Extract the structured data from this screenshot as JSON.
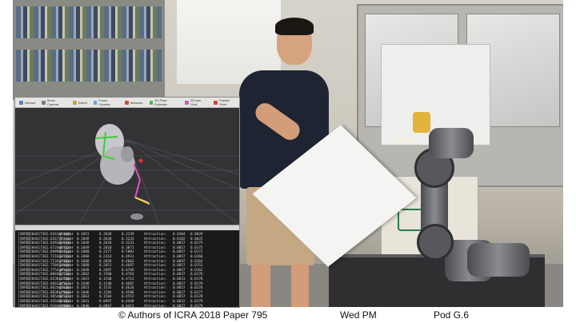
{
  "rviz": {
    "toolbar": [
      {
        "label": "Interact",
        "icon": "interact-icon",
        "color": "#5b7fbf"
      },
      {
        "label": "Move Camera",
        "icon": "move-camera-icon",
        "color": "#7d7d7d"
      },
      {
        "label": "Select",
        "icon": "select-icon",
        "color": "#c9a13a"
      },
      {
        "label": "Focus Camera",
        "icon": "focus-camera-icon",
        "color": "#6aa0d8"
      },
      {
        "label": "Measure",
        "icon": "measure-icon",
        "color": "#d04b3b"
      },
      {
        "label": "2D Pose Estimate",
        "icon": "pose-estimate-icon",
        "color": "#4caf50"
      },
      {
        "label": "2D Nav Goal",
        "icon": "nav-goal-icon",
        "color": "#c65ab8"
      },
      {
        "label": "Publish Point",
        "icon": "publish-point-icon",
        "color": "#d8442f"
      }
    ],
    "status_left": "",
    "status_right": "",
    "log_rows": [
      [
        "[INFO]",
        "[1504417362.616165469]:",
        "gripper",
        "0.1051",
        "0.2628",
        "0.3239",
        "Attraction:",
        "0.0204",
        "0.0029"
      ],
      [
        "[INFO]",
        "[1504417362.626775314]:",
        "gripper",
        "0.1049",
        "0.2628",
        "0.3233",
        "Attraction:",
        "0.0102",
        "0.0025"
      ],
      [
        "[INFO]",
        "[1504417362.646364819]:",
        "gripper",
        "0.1049",
        "0.2628",
        "0.3233",
        "Attraction:",
        "0.0057",
        "0.0175"
      ],
      [
        "[INFO]",
        "[1504417362.672446352]:",
        "gripper",
        "0.1049",
        "0.2610",
        "0.3071",
        "Attraction:",
        "0.0057",
        "0.0175"
      ],
      [
        "[INFO]",
        "[1504417362.698993453]:",
        "gripper",
        "0.1060",
        "0.2377",
        "0.5083",
        "Attraction:",
        "0.0057",
        "0.0172"
      ],
      [
        "[INFO]",
        "[1504417362.721643375]:",
        "gripper",
        "0.1060",
        "0.2314",
        "0.4931",
        "Attraction:",
        "0.0057",
        "0.0166"
      ],
      [
        "[INFO]",
        "[1504417362.723437485]:",
        "gripper",
        "0.1068",
        "0.2058",
        "0.4802",
        "Attraction:",
        "0.0097",
        "0.0164"
      ],
      [
        "[INFO]",
        "[1504417362.758431849]:",
        "gripper",
        "0.1060",
        "0.2051",
        "0.4697",
        "Attraction:",
        "0.0057",
        "0.0153"
      ],
      [
        "[INFO]",
        "[1504417362.775439545]:",
        "gripper",
        "0.1049",
        "0.2097",
        "0.4769",
        "Attraction:",
        "0.0057",
        "0.0162"
      ],
      [
        "[INFO]",
        "[1504417362.804482176]:",
        "gripper",
        "0.1062",
        "0.1560",
        "0.4763",
        "Attraction:",
        "0.0037",
        "0.0176"
      ],
      [
        "[INFO]",
        "[1504417362.823813758]:",
        "gripper",
        "0.1041",
        "0.1540",
        "0.4713",
        "Attraction:",
        "0.0031",
        "0.0178"
      ],
      [
        "[INFO]",
        "[1504417362.846334561]:",
        "gripper",
        "0.1048",
        "0.1540",
        "0.4687",
        "Attraction:",
        "0.0057",
        "0.0178"
      ],
      [
        "[INFO]",
        "[1504417362.862445836]:",
        "gripper",
        "0.1053",
        "0.1535",
        "0.4626",
        "Attraction:",
        "0.0057",
        "0.0176"
      ],
      [
        "[INFO]",
        "[1504417362.883817969]:",
        "gripper",
        "0.1046",
        "0.1504",
        "0.4586",
        "Attraction:",
        "0.0027",
        "0.0177"
      ],
      [
        "[INFO]",
        "[1504417362.905446137]:",
        "gripper",
        "0.1063",
        "0.1504",
        "0.4552",
        "Attraction:",
        "0.0057",
        "0.0178"
      ],
      [
        "[INFO]",
        "[1504417362.926485405]:",
        "gripper",
        "0.1041",
        "0.0997",
        "0.4448",
        "Attraction:",
        "0.0022",
        "0.0179"
      ],
      [
        "[INFO]",
        "[1504417362.934424809]:",
        "gripper",
        "0.1046",
        "0.0967",
        "0.4413",
        "Attraction:",
        "0.0057",
        "0.0179"
      ],
      [
        "[INFO]",
        "[1504417362.956438112]:",
        "gripper",
        "0.1048",
        "0.0033",
        "0.4369",
        "Attraction:",
        "0.0057",
        "0.0179"
      ],
      [
        "[INFO]",
        "[1504417362.968751926]:",
        "gripper",
        "0.1046",
        "0.0033",
        "0.4350",
        "Attraction:",
        "0.0057",
        "0.0180"
      ],
      [
        "[INFO]",
        "[1504417362.985621843]:",
        "gripper",
        "0.1061",
        "0.0033",
        "0.4339",
        "Attraction:",
        "0.0057",
        "0.0180"
      ]
    ]
  },
  "caption": {
    "credit": "© Authors of ICRA 2018 Paper 795",
    "session": "Wed PM",
    "pod": "Pod G.6"
  }
}
